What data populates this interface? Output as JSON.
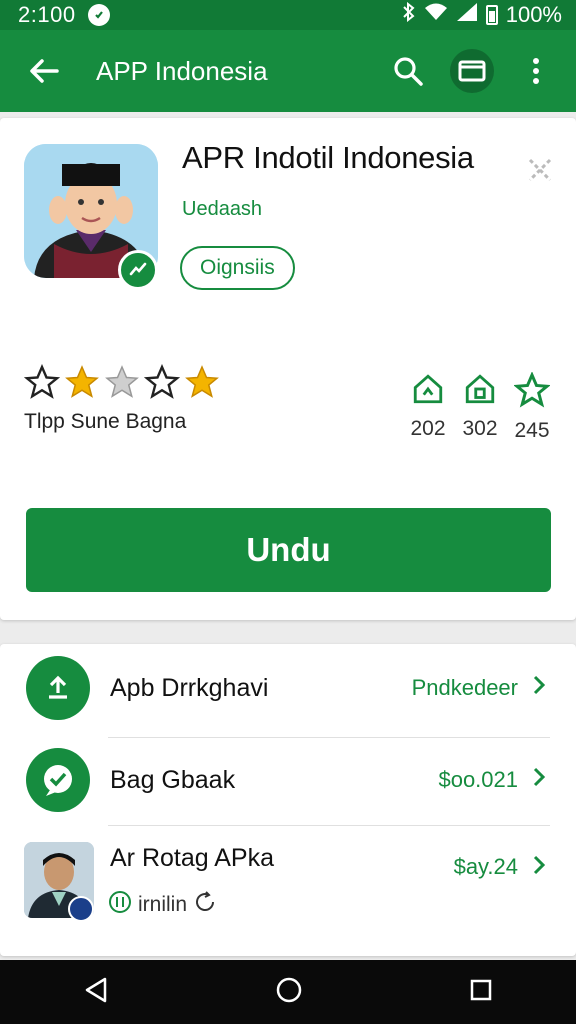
{
  "status_bar": {
    "time": "2:100",
    "battery": "100%"
  },
  "app_bar": {
    "title": "APP Indonesia",
    "back_icon": "arrow-left-icon",
    "actions": [
      "search-icon",
      "tablet-icon",
      "more-vert-icon"
    ]
  },
  "app": {
    "title": "APR Indotil Indonesia",
    "developer": "Uedaash",
    "category": "Oignsiis",
    "rating_label": "Tlpp Sune Bagna",
    "stars": [
      "outline",
      "filled",
      "grey",
      "outline",
      "filled"
    ],
    "stats": [
      {
        "icon": "home-badge-icon",
        "value": "202"
      },
      {
        "icon": "home-badge-icon",
        "value": "302"
      },
      {
        "icon": "star-outline-icon",
        "value": "245"
      }
    ],
    "install_label": "Undu"
  },
  "list": [
    {
      "icon": "download-circle-icon",
      "label": "Apb Drrkghavi",
      "value": "Pndkedeer"
    },
    {
      "icon": "check-chat-icon",
      "label": "Bag Gbaak",
      "value": "$oo.021"
    },
    {
      "icon": "avatar",
      "label": "Ar Rotag APka",
      "value": "$ay.24",
      "sub": "irnilin"
    }
  ],
  "colors": {
    "primary": "#168c3f",
    "primary_dark": "#117a36",
    "star": "#f4b400"
  }
}
